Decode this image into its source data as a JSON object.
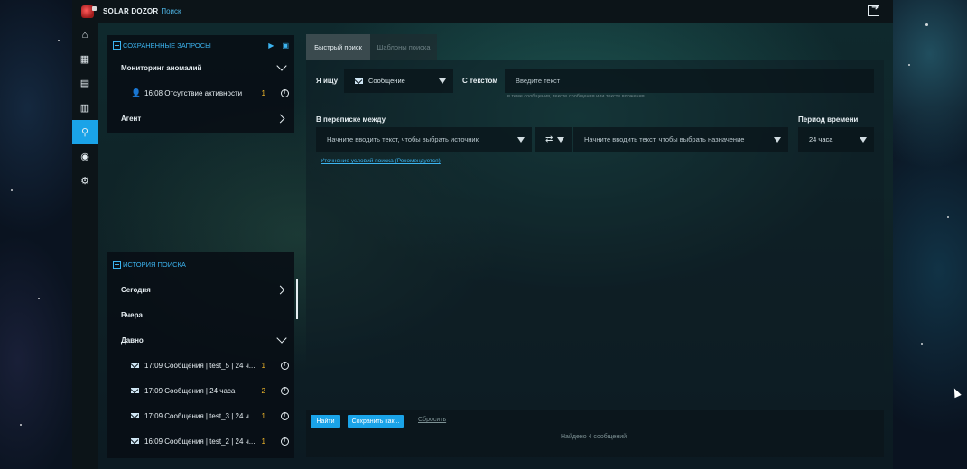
{
  "app": {
    "brand": "SOLAR DOZOR",
    "crumb": "Поиск"
  },
  "nav": {
    "items": [
      {
        "icon": "home-icon"
      },
      {
        "icon": "org-icon"
      },
      {
        "icon": "persons-icon"
      },
      {
        "icon": "calendar-icon"
      },
      {
        "icon": "search-icon",
        "active": true
      },
      {
        "icon": "agent-icon"
      },
      {
        "icon": "settings-icon"
      }
    ]
  },
  "saved": {
    "title": "Сохраненные запросы",
    "groups": [
      {
        "label": "Мониторинг аномалий",
        "expanded": true
      },
      {
        "label": "Агент",
        "expanded": false
      }
    ],
    "items": [
      {
        "label": "16:08 Отсутствие активности",
        "count": "1"
      }
    ]
  },
  "history": {
    "title": "История поиска",
    "groups": [
      {
        "label": "Сегодня"
      },
      {
        "label": "Вчера"
      },
      {
        "label": "Давно"
      }
    ],
    "items": [
      {
        "label": "17:09 Сообщения | test_5 | 24 ч...",
        "count": "1"
      },
      {
        "label": "17:09 Сообщения | 24 часа",
        "count": "2"
      },
      {
        "label": "17:09 Сообщения | test_3 | 24 ч...",
        "count": "1"
      },
      {
        "label": "16:09 Сообщения | test_2 | 24 ч...",
        "count": "1"
      }
    ]
  },
  "tabs": [
    {
      "label": "Быстрый поиск",
      "active": true
    },
    {
      "label": "Шаблоны поиска",
      "active": false
    }
  ],
  "search": {
    "i_search_label": "Я ищу",
    "object_type": "Сообщение",
    "with_text_label": "С текстом",
    "text_placeholder": "Введите текст",
    "text_hint": "в теме сообщения, тексте сообщения или тексте вложения",
    "between_label": "В переписке между",
    "source_placeholder": "Начните вводить текст, чтобы выбрать источник",
    "dest_placeholder": "Начните вводить текст, чтобы выбрать назначение",
    "period_label": "Период времени",
    "period_value": "24 часа",
    "refine_link": "Уточнение условий поиска (Рекомендуется)"
  },
  "actions": {
    "find": "Найти",
    "save_as": "Сохранить как...",
    "reset": "Сбросить",
    "status": "Найдено 4 сообщений"
  },
  "colors": {
    "accent": "#1aa3e8",
    "count": "#f0b72a",
    "header_text": "#3cb4f0"
  }
}
